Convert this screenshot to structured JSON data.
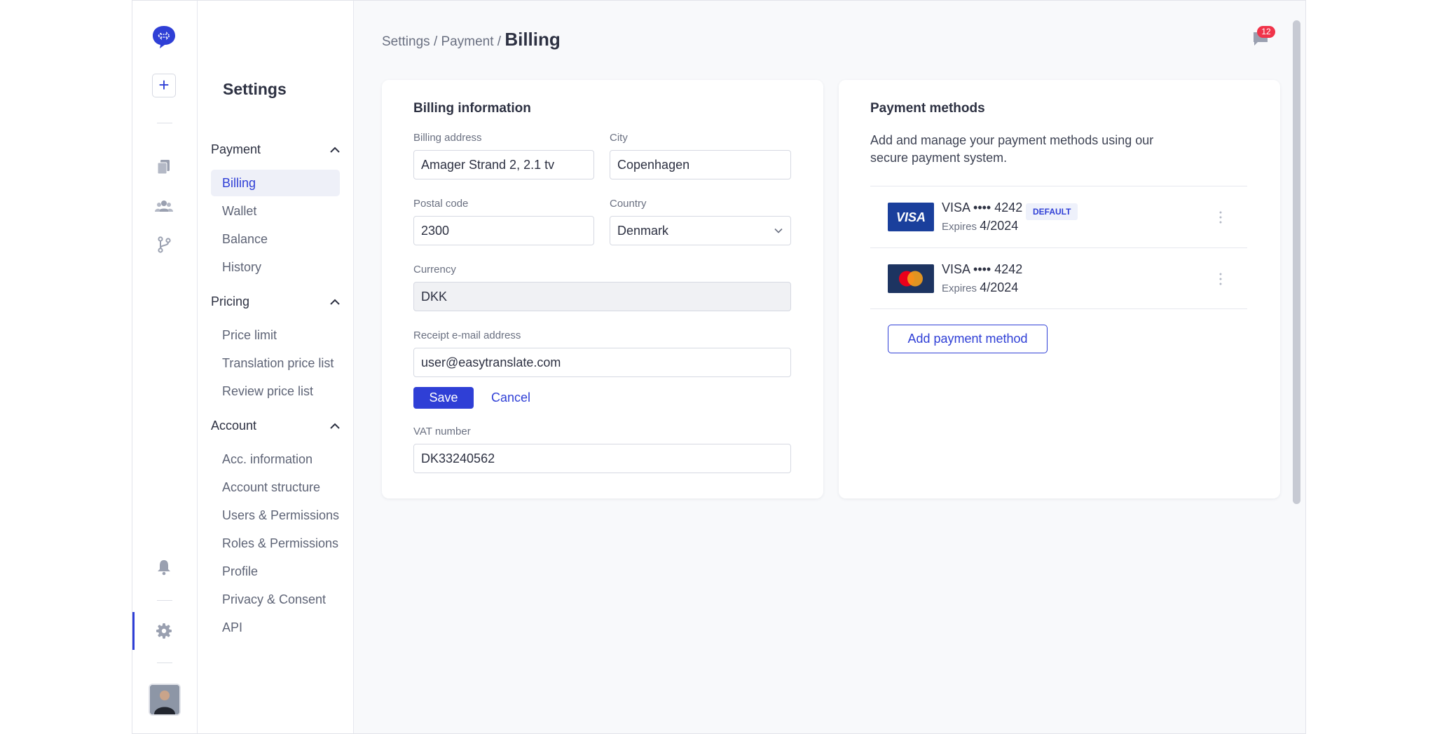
{
  "rail": {
    "new_label": "+",
    "colors": {
      "accent": "#2f3fd6"
    }
  },
  "sidebar": {
    "title": "Settings",
    "groups": [
      {
        "label": "Payment",
        "items": [
          "Billing",
          "Wallet",
          "Balance",
          "History"
        ]
      },
      {
        "label": "Pricing",
        "items": [
          "Price limit",
          "Translation price list",
          "Review price list"
        ]
      },
      {
        "label": "Account",
        "items": [
          "Acc. information",
          "Account structure",
          "Users & Permissions",
          "Roles & Permissions",
          "Profile",
          "Privacy & Consent",
          "API"
        ]
      }
    ],
    "active_item": "Billing"
  },
  "header": {
    "crumb_1": "Settings",
    "sep": "/",
    "crumb_2": "Payment",
    "current": "Billing",
    "notification_count": "12"
  },
  "billing": {
    "title": "Billing information",
    "address_label": "Billing address",
    "address_value": "Amager Strand 2, 2.1 tv",
    "city_label": "City",
    "city_value": "Copenhagen",
    "postal_label": "Postal code",
    "postal_value": "2300",
    "country_label": "Country",
    "country_value": "Denmark",
    "currency_label": "Currency",
    "currency_value": "DKK",
    "email_label": "Receipt e-mail address",
    "email_value": "user@easytranslate.com",
    "save_label": "Save",
    "cancel_label": "Cancel",
    "vat_label": "VAT number",
    "vat_value": "DK33240562"
  },
  "payment": {
    "title": "Payment methods",
    "description": "Add and manage your payment methods using our secure payment system.",
    "cards": [
      {
        "brand": "VISA",
        "number": "VISA •••• 4242",
        "expires_label": "Expires",
        "expires_value": "4/2024",
        "default_label": "DEFAULT"
      },
      {
        "brand": "MasterCard",
        "number": "VISA •••• 4242",
        "expires_label": "Expires",
        "expires_value": "4/2024"
      }
    ],
    "add_label": "Add payment method"
  }
}
